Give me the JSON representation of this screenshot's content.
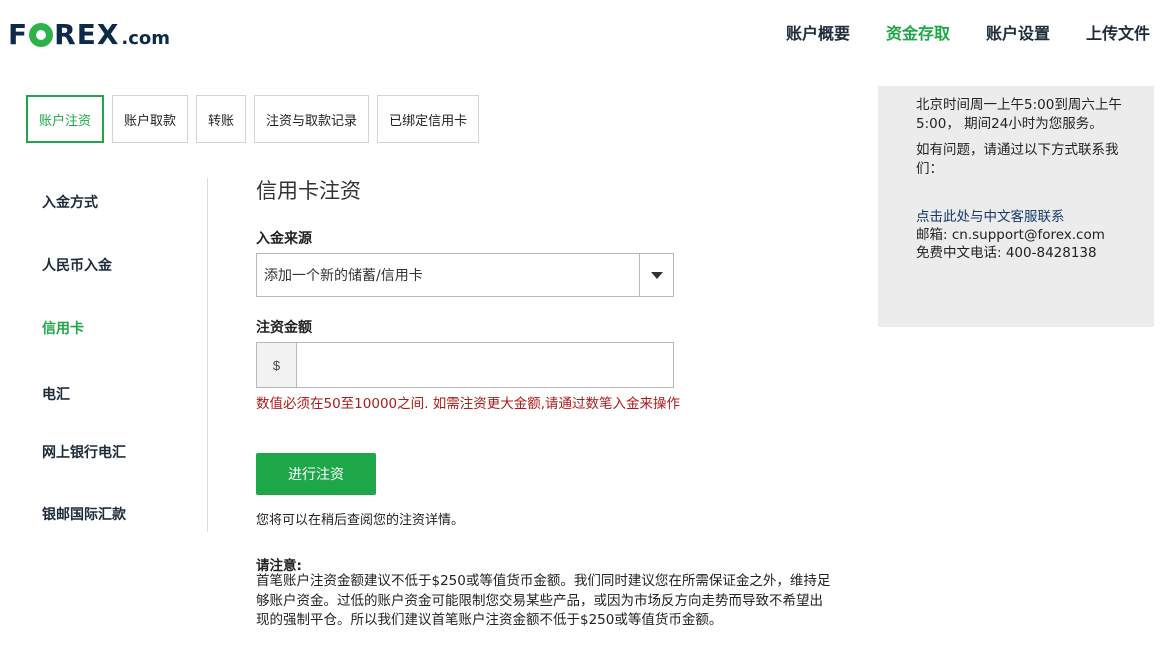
{
  "brand": {
    "logo_f": "F",
    "logo_rest": "REX",
    "logo_suffix": ".com"
  },
  "topnav": [
    {
      "label": "账户概要",
      "active": false
    },
    {
      "label": "资金存取",
      "active": true
    },
    {
      "label": "账户设置",
      "active": false
    },
    {
      "label": "上传文件",
      "active": false
    }
  ],
  "tabs": [
    {
      "label": "账户注资",
      "active": true
    },
    {
      "label": "账户取款",
      "active": false
    },
    {
      "label": "转账",
      "active": false
    },
    {
      "label": "注资与取款记录",
      "active": false
    },
    {
      "label": "已绑定信用卡",
      "active": false
    }
  ],
  "sidebar": {
    "items": [
      {
        "label": "入金方式",
        "active": false
      },
      {
        "label": "人民币入金",
        "active": false
      },
      {
        "label": "信用卡",
        "active": true
      },
      {
        "label": "电汇",
        "active": false
      },
      {
        "label": "网上银行电汇",
        "active": false
      },
      {
        "label": "银邮国际汇款",
        "active": false
      }
    ]
  },
  "main": {
    "title": "信用卡注资",
    "source_label": "入金来源",
    "source_value": "添加一个新的储蓄/信用卡",
    "amount_label": "注资金额",
    "currency_prefix": "$",
    "amount_value": "",
    "error_text": "数值必须在50至10000之间. 如需注资更大金额,请通过数笔入金来操作",
    "submit_label": "进行注资",
    "after_text": "您将可以在稍后查阅您的注资详情。",
    "notice_title": "请注意:",
    "notice_body": "首笔账户注资金额建议不低于$250或等值货币金额。我们同时建议您在所需保证金之外，维持足够账户资金。过低的账户资金可能限制您交易某些产品，或因为市场反方向走势而导致不希望出现的强制平仓。所以我们建议首笔账户注资金额不低于$250或等值货币金额。"
  },
  "info_panel": {
    "hours": "北京时间周一上午5:00到周六上午5:00， 期间24小时为您服务。",
    "question": "如有问题，请通过以下方式联系我们：",
    "contact_link": "点击此处与中文客服联系",
    "email": "邮箱: cn.support@forex.com",
    "phone": "免费中文电话: 400-8428138"
  },
  "colors": {
    "accent": "#1ea749",
    "error": "#b01a1a",
    "panel_bg": "#ececec",
    "navy": "#0e2a4a"
  }
}
